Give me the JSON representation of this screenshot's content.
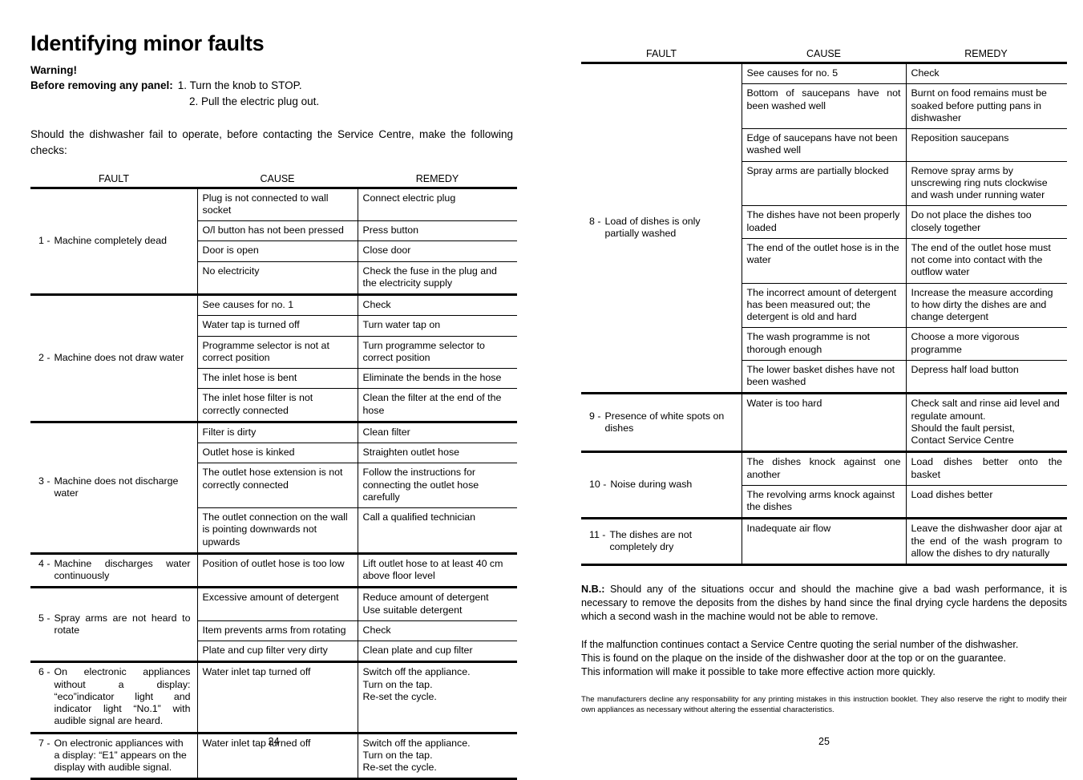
{
  "left_page": {
    "title": "Identifying minor faults",
    "warning": "Warning!",
    "panel_label": "Before removing any panel:",
    "panel_step_1": "1. Turn the knob to STOP.",
    "panel_step_2": "2. Pull the electric plug out.",
    "intro": "Should the dishwasher fail to operate, before contacting the Service Centre, make the following checks:",
    "columns": {
      "fault": "FAULT",
      "cause": "CAUSE",
      "remedy": "REMEDY"
    },
    "page_number": "24",
    "groups": [
      {
        "number": "1 -",
        "fault": "Machine completely dead",
        "justify": false,
        "rows": [
          {
            "cause": "Plug is not connected to wall socket",
            "remedy": "Connect electric plug"
          },
          {
            "cause": "O/l button has not been pressed",
            "remedy": "Press button"
          },
          {
            "cause": "Door is open",
            "remedy": "Close door"
          },
          {
            "cause": "No electricity",
            "remedy": "Check the fuse in the plug and the electricity supply"
          }
        ]
      },
      {
        "number": "2 -",
        "fault": "Machine does not draw water",
        "justify": false,
        "rows": [
          {
            "cause": "See causes for no. 1",
            "remedy": "Check"
          },
          {
            "cause": "Water tap is turned off",
            "remedy": "Turn water tap on"
          },
          {
            "cause": "Programme selector is not at correct position",
            "remedy": "Turn programme selector to correct position"
          },
          {
            "cause": "The inlet hose is bent",
            "remedy": "Eliminate the bends in the hose"
          },
          {
            "cause": "The inlet hose filter is not correctly connected",
            "remedy": "Clean the filter at the end of the hose"
          }
        ]
      },
      {
        "number": "3 -",
        "fault": "Machine does not discharge water",
        "justify": false,
        "rows": [
          {
            "cause": "Filter is dirty",
            "remedy": "Clean filter"
          },
          {
            "cause": "Outlet hose is kinked",
            "remedy": "Straighten outlet hose"
          },
          {
            "cause": "The outlet hose extension is not correctly connected",
            "remedy": "Follow the instructions for connecting the outlet hose carefully"
          },
          {
            "cause": "The outlet connection on the wall is pointing downwards not upwards",
            "remedy": "Call a qualified technician"
          }
        ]
      },
      {
        "number": "4 -",
        "fault": "Machine discharges water continuously",
        "justify": true,
        "rows": [
          {
            "cause": "Position of outlet hose is too low",
            "remedy": "Lift outlet hose to at least 40 cm above floor level"
          }
        ]
      },
      {
        "number": "5 -",
        "fault": "Spray arms are not heard to rotate",
        "justify": true,
        "rows": [
          {
            "cause": "Excessive amount of detergent",
            "remedy": "Reduce amount of detergent\nUse suitable detergent"
          },
          {
            "cause": "Item prevents arms from rotating",
            "remedy": "Check"
          },
          {
            "cause": "Plate and cup filter very dirty",
            "remedy": "Clean plate and cup filter"
          }
        ]
      },
      {
        "number": "6 -",
        "fault": "On electronic appliances without a display: “eco”indicator light  and indicator light “No.1” with audible signal are heard.",
        "justify": true,
        "rows": [
          {
            "cause": "Water inlet tap turned off",
            "remedy": "Switch off the appliance.\nTurn on the tap.\nRe-set the cycle."
          }
        ]
      },
      {
        "number": "7 -",
        "fault": "On electronic appliances with a display: “E1” appears on the display with audible signal.",
        "justify": false,
        "rows": [
          {
            "cause": "Water inlet tap turned off",
            "remedy": "Switch off the appliance.\nTurn on the tap.\nRe-set the cycle."
          }
        ]
      }
    ]
  },
  "right_page": {
    "columns": {
      "fault": "FAULT",
      "cause": "CAUSE",
      "remedy": "REMEDY"
    },
    "page_number": "25",
    "groups": [
      {
        "number": "8 -",
        "fault": "Load of dishes is only partially washed",
        "justify": false,
        "rows": [
          {
            "cause": "See causes for no. 5",
            "remedy": "Check"
          },
          {
            "cause": "Bottom of saucepans have not been washed well",
            "cause_justify": true,
            "remedy": "Burnt on food remains must be soaked before putting pans in dishwasher"
          },
          {
            "cause": "Edge of saucepans have not been washed well",
            "remedy": "Reposition saucepans"
          },
          {
            "cause": "Spray arms are partially blocked",
            "remedy": "Remove spray arms by unscrewing ring nuts clockwise and wash under running water"
          },
          {
            "cause": "The dishes have not been properly loaded",
            "remedy": "Do not place the dishes too closely together"
          },
          {
            "cause": "The end of the outlet hose is in the water",
            "remedy": "The end of the outlet hose must not come into contact with the outflow water"
          },
          {
            "cause": "The incorrect amount of detergent has been measured out; the detergent is old and hard",
            "remedy": "Increase the measure according to how dirty the dishes are and change detergent"
          },
          {
            "cause": "The wash programme is not thorough enough",
            "remedy": "Choose a more vigorous programme"
          },
          {
            "cause": "The lower basket dishes have not been washed",
            "remedy": "Depress half load button"
          }
        ]
      },
      {
        "number": "9 -",
        "fault": "Presence of white spots on dishes",
        "justify": false,
        "rows": [
          {
            "cause": "Water is too hard",
            "remedy": "Check salt and rinse aid level and regulate amount.\nShould the fault persist,\nContact Service Centre"
          }
        ]
      },
      {
        "number": "10 -",
        "fault": "Noise during wash",
        "justify": false,
        "rows": [
          {
            "cause": "The dishes knock against one another",
            "cause_justify": true,
            "remedy": "Load dishes better onto the basket",
            "remedy_justify": true
          },
          {
            "cause": "The revolving arms knock against the dishes",
            "remedy": "Load dishes better"
          }
        ]
      },
      {
        "number": "11 -",
        "fault": "The dishes are not completely dry",
        "justify": false,
        "rows": [
          {
            "cause": "Inadequate air flow",
            "remedy": "Leave the dishwasher door ajar at the end of the wash program to allow the dishes to dry naturally",
            "remedy_justify": true
          }
        ]
      }
    ],
    "nb_label": "N.B.:",
    "nb_text": " Should any of the situations occur and should the machine give a bad wash performance, it is necessary to remove the deposits from the dishes by hand since the final drying cycle hardens the deposits which a second wash in the machine would not be able to remove.",
    "service_line_1": "If the malfunction continues contact a Service Centre quoting the serial number of the dishwasher.",
    "service_line_2": "This is found on the plaque on the inside of the dishwasher door at the top or on the guarantee.",
    "service_line_3": "This information will make it possible to take more effective action more quickly.",
    "disclaimer": "The manufacturers decline any responsability for any printing mistakes in this instruction booklet. They also reserve the right to modify their own appliances as necessary without altering the essential characteristics."
  }
}
